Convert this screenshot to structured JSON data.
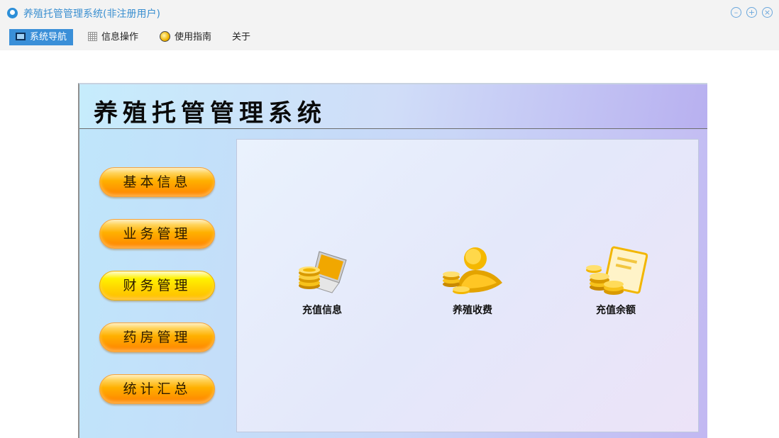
{
  "window": {
    "title": "养殖托管管理系统(非注册用户)",
    "controls": [
      "minimize-icon",
      "maximize-icon",
      "close-icon"
    ]
  },
  "menubar": {
    "items": [
      {
        "label": "系统导航",
        "icon": "monitor-icon",
        "active": true
      },
      {
        "label": "信息操作",
        "icon": "grid-icon",
        "active": false
      },
      {
        "label": "使用指南",
        "icon": "guide-icon",
        "active": false
      },
      {
        "label": "关于",
        "icon": "",
        "active": false
      }
    ]
  },
  "banner": {
    "title": "养殖托管管理系统"
  },
  "sidebar": {
    "buttons": [
      {
        "label": "基本信息"
      },
      {
        "label": "业务管理"
      },
      {
        "label": "财务管理"
      },
      {
        "label": "药房管理"
      },
      {
        "label": "统计汇总"
      }
    ]
  },
  "tiles": [
    {
      "label": "充值信息",
      "icon": "laptop-coins-icon"
    },
    {
      "label": "养殖收费",
      "icon": "coin-person-icon"
    },
    {
      "label": "充值余额",
      "icon": "coin-card-icon"
    }
  ],
  "colors": {
    "accent": "#3a8fd8",
    "button_orange": "#ff9b00",
    "button_yellow": "#ffd800",
    "coin_gold": "#f2b600"
  }
}
